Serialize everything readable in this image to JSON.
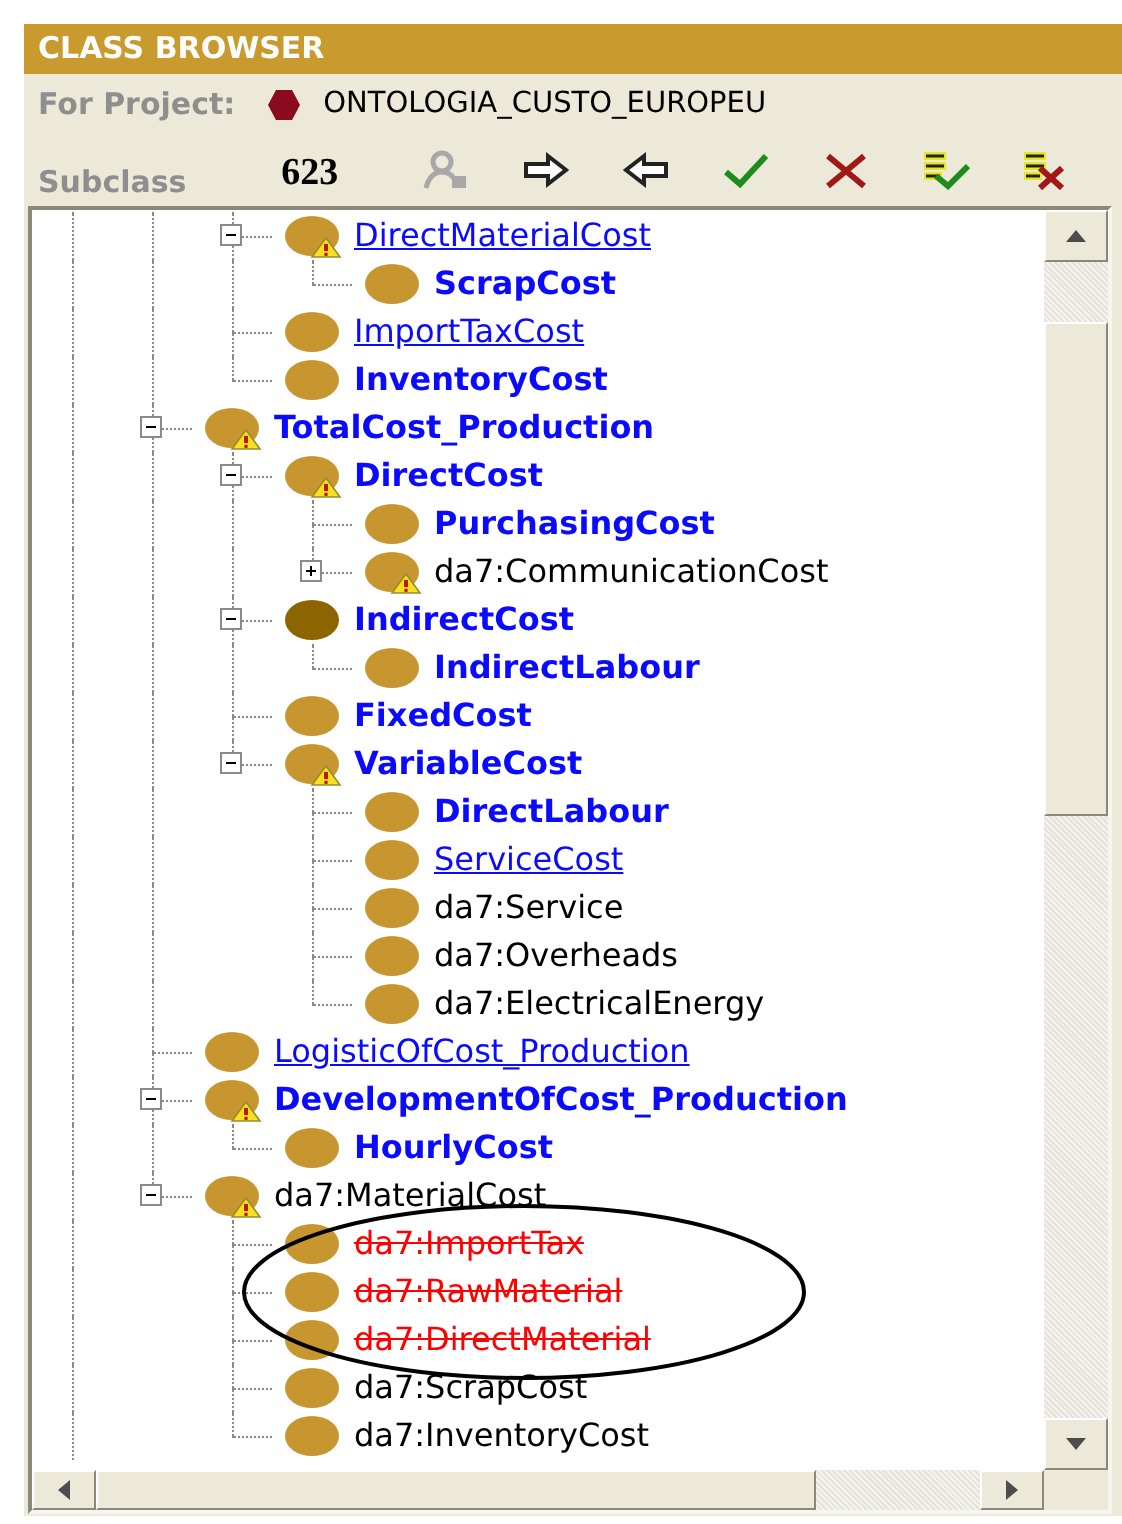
{
  "panel": {
    "title": "CLASS BROWSER"
  },
  "project": {
    "label": "For Project:",
    "name": "ONTOLOGIA_CUSTO_EUROPEU"
  },
  "toolbar": {
    "label": "Subclass",
    "count": "623",
    "buttons": [
      {
        "kind": "person",
        "disabled": true
      },
      {
        "kind": "arrow-right",
        "disabled": false
      },
      {
        "kind": "arrow-left",
        "disabled": false
      },
      {
        "kind": "check",
        "disabled": false
      },
      {
        "kind": "cross",
        "disabled": false
      },
      {
        "kind": "list-check",
        "disabled": false
      },
      {
        "kind": "list-cross",
        "disabled": false
      }
    ]
  },
  "tree": {
    "items": [
      {
        "children": [
          {
            "label": "DirectMaterialCost",
            "kind": "link",
            "warning": true,
            "color": "#c8962e",
            "expanded": true,
            "children": [
              {
                "label": "ScrapCost",
                "kind": "defined",
                "warning": false,
                "color": "#c8962e"
              }
            ]
          },
          {
            "label": "ImportTaxCost",
            "kind": "link",
            "warning": false,
            "color": "#c8962e"
          },
          {
            "label": "InventoryCost",
            "kind": "defined",
            "warning": false,
            "color": "#c8962e"
          }
        ]
      },
      {
        "label": "TotalCost_Production",
        "kind": "defined",
        "warning": true,
        "color": "#c8962e",
        "expanded": true,
        "children": [
          {
            "label": "DirectCost",
            "kind": "defined",
            "warning": true,
            "color": "#c8962e",
            "expanded": true,
            "children": [
              {
                "label": "PurchasingCost",
                "kind": "defined",
                "warning": false,
                "color": "#c8962e"
              },
              {
                "label": "da7:CommunicationCost",
                "kind": "imported",
                "warning": true,
                "color": "#c8962e",
                "expanded": false
              }
            ]
          },
          {
            "label": "IndirectCost",
            "kind": "defined",
            "warning": false,
            "color": "#8c6400",
            "expanded": true,
            "children": [
              {
                "label": "IndirectLabour",
                "kind": "defined",
                "warning": false,
                "color": "#c8962e"
              }
            ]
          },
          {
            "label": "FixedCost",
            "kind": "defined",
            "warning": false,
            "color": "#c8962e"
          },
          {
            "label": "VariableCost",
            "kind": "defined",
            "warning": true,
            "color": "#c8962e",
            "expanded": true,
            "children": [
              {
                "label": "DirectLabour",
                "kind": "defined",
                "warning": false,
                "color": "#c8962e"
              },
              {
                "label": "ServiceCost",
                "kind": "link",
                "warning": false,
                "color": "#c8962e"
              },
              {
                "label": "da7:Service",
                "kind": "imported",
                "warning": false,
                "color": "#c8962e"
              },
              {
                "label": "da7:Overheads",
                "kind": "imported",
                "warning": false,
                "color": "#c8962e"
              },
              {
                "label": "da7:ElectricalEnergy",
                "kind": "imported",
                "warning": false,
                "color": "#c8962e"
              }
            ]
          }
        ]
      },
      {
        "label": "LogisticOfCost_Production",
        "kind": "link",
        "warning": false,
        "color": "#c8962e"
      },
      {
        "label": "DevelopmentOfCost_Production",
        "kind": "defined",
        "warning": true,
        "color": "#c8962e",
        "expanded": true,
        "children": [
          {
            "label": "HourlyCost",
            "kind": "defined",
            "warning": false,
            "color": "#c8962e"
          }
        ]
      },
      {
        "label": "da7:MaterialCost",
        "kind": "imported",
        "warning": true,
        "color": "#c8962e",
        "expanded": true,
        "children": [
          {
            "label": "da7:ImportTax",
            "kind": "deleted",
            "warning": false,
            "color": "#c8962e"
          },
          {
            "label": "da7:RawMaterial",
            "kind": "deleted",
            "warning": false,
            "color": "#c8962e"
          },
          {
            "label": "da7:DirectMaterial",
            "kind": "deleted",
            "warning": false,
            "color": "#c8962e"
          },
          {
            "label": "da7:ScrapCost",
            "kind": "imported",
            "warning": false,
            "color": "#c8962e"
          },
          {
            "label": "da7:InventoryCost",
            "kind": "imported",
            "warning": false,
            "color": "#c8962e"
          }
        ]
      }
    ]
  }
}
